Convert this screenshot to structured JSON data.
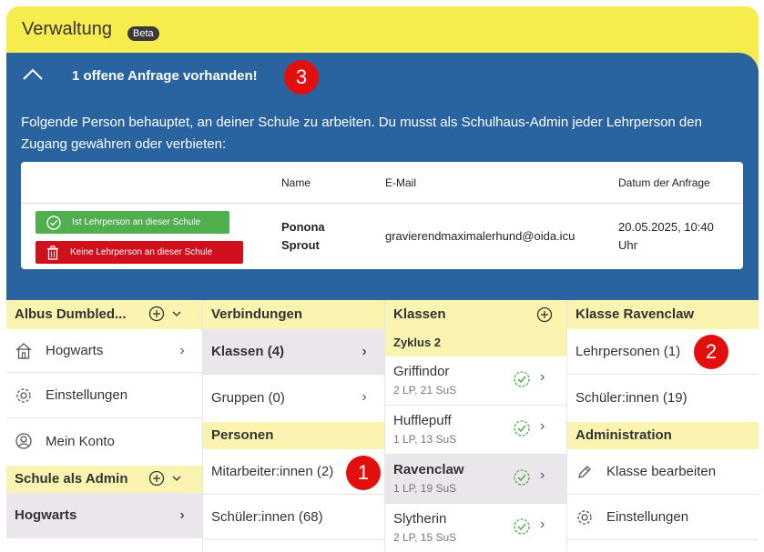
{
  "app": {
    "title": "Verwaltung",
    "beta": "Beta"
  },
  "request_panel": {
    "headline": "1 offene Anfrage vorhanden!",
    "description": "Folgende Person behauptet, an deiner Schule zu arbeiten. Du musst als Schulhaus-Admin jeder Lehrperson den Zugang gewähren oder verbieten:",
    "columns": [
      "Name",
      "E-Mail",
      "Datum der Anfrage"
    ],
    "rows": [
      {
        "name": "Ponona Sprout",
        "email": "gravierendmaximalerhund@oida.icu",
        "date": "20.05.2025, 10:40 Uhr"
      }
    ],
    "approve_label": "Ist Lehrperson an dieser Schule",
    "reject_label": "Keine Lehrperson an dieser Schule"
  },
  "badges": {
    "b1": "1",
    "b2": "2",
    "b3": "3"
  },
  "col1": {
    "head": "Albus Dumbled...",
    "items": [
      {
        "label": "Hogwarts",
        "icon": "house-icon"
      },
      {
        "label": "Einstellungen",
        "icon": "gear-icon"
      },
      {
        "label": "Mein Konto",
        "icon": "user-circle-icon"
      }
    ],
    "section": "Schule als Admin",
    "school": "Hogwarts"
  },
  "col2": {
    "head": "Verbindungen",
    "items": [
      {
        "label": "Klassen (4)"
      },
      {
        "label": "Gruppen (0)"
      }
    ],
    "section": "Personen",
    "persons": [
      {
        "label": "Mitarbeiter:innen (2)"
      },
      {
        "label": "Schüler:innen (68)"
      }
    ]
  },
  "col3": {
    "head": "Klassen",
    "cycle": "Zyklus 2",
    "classes": [
      {
        "name": "Griffindor",
        "meta": "2 LP, 21 SuS"
      },
      {
        "name": "Hufflepuff",
        "meta": "1 LP, 13 SuS"
      },
      {
        "name": "Ravenclaw",
        "meta": "1 LP, 19 SuS"
      },
      {
        "name": "Slytherin",
        "meta": "2 LP, 15 SuS"
      }
    ]
  },
  "col4": {
    "head": "Klasse Ravenclaw",
    "items": [
      {
        "label": "Lehrpersonen (1)"
      },
      {
        "label": "Schüler:innen (19)"
      }
    ],
    "section": "Administration",
    "admin": [
      {
        "label": "Klasse bearbeiten",
        "icon": "pencil-icon"
      },
      {
        "label": "Einstellungen",
        "icon": "gear-icon"
      }
    ]
  },
  "colors": {
    "yellow": "#f7ec4e",
    "blue": "#2a64a0",
    "green": "#4fae4e",
    "red": "#d0101c",
    "badge": "#e30f0f"
  }
}
